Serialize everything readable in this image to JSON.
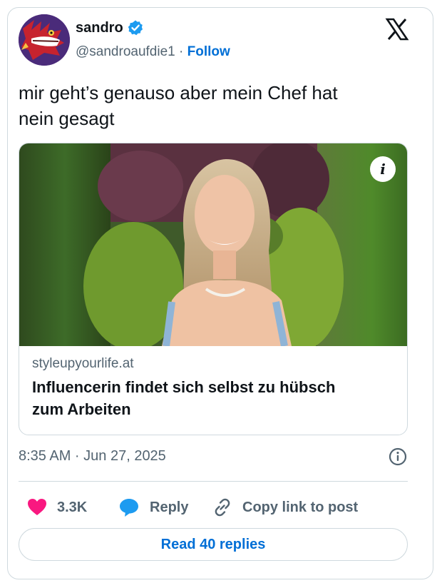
{
  "author": {
    "name": "sandro",
    "handle": "@sandroaufdie1",
    "separator": " · ",
    "follow_label": "Follow"
  },
  "tweet": {
    "text_line1": "mir geht’s genauso aber mein Chef hat",
    "text_line2": "nein gesagt"
  },
  "link_card": {
    "info_glyph": "i",
    "domain": "styleupyourlife.at",
    "title_line1": "Influencerin findet sich selbst zu hübsch",
    "title_line2": "zum Arbeiten"
  },
  "meta": {
    "timestamp": "8:35 AM · Jun 27, 2025"
  },
  "actions": {
    "like_count": "3.3K",
    "reply_label": "Reply",
    "copy_label": "Copy link to post"
  },
  "replies_button": "Read 40 replies",
  "colors": {
    "accent": "#006fd6",
    "like": "#f91880",
    "reply": "#1d9bf0",
    "verified": "#1d9bf0"
  }
}
